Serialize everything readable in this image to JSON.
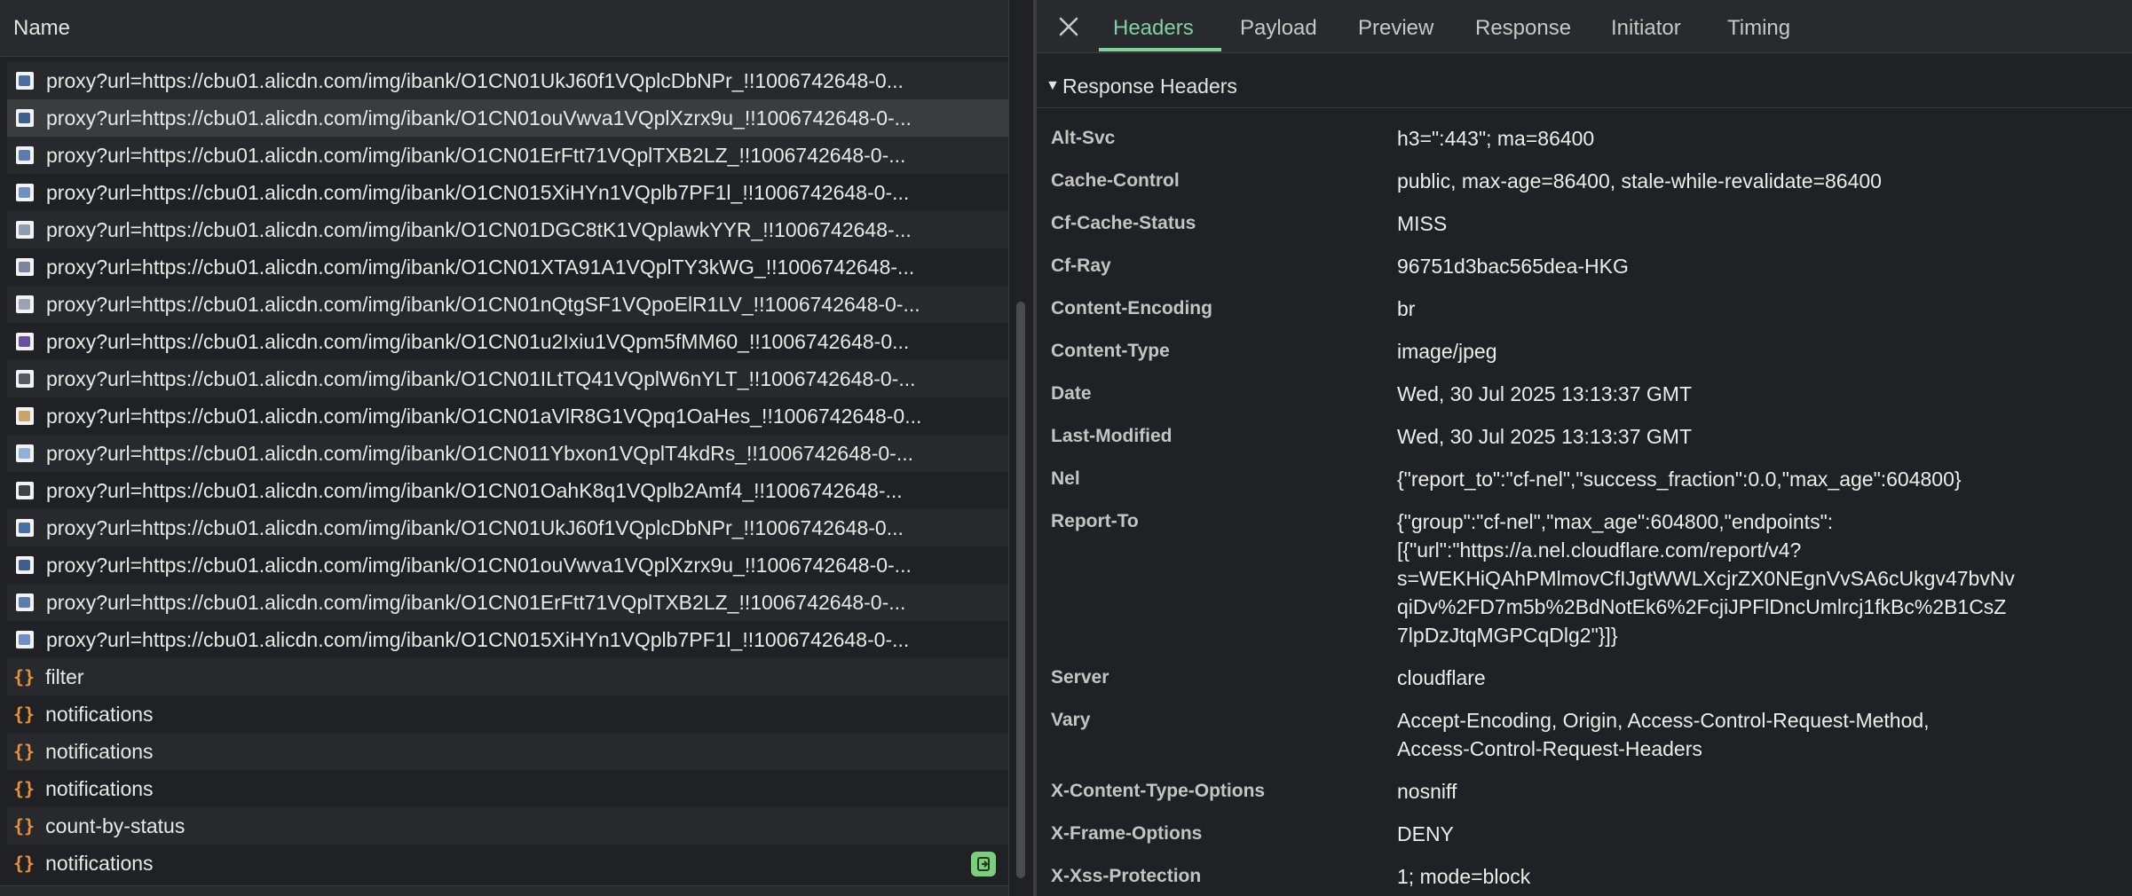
{
  "list": {
    "header": "Name",
    "rows": [
      {
        "name": "proxy?url=https://cbu01.alicdn.com/img/ibank/O1CN01UkJ60f1VQplcDbNPr_!!1006742648-0...",
        "kind": "image",
        "thumb": "#4a6fa5"
      },
      {
        "name": "proxy?url=https://cbu01.alicdn.com/img/ibank/O1CN01ouVwva1VQplXzrx9u_!!1006742648-0-...",
        "kind": "image",
        "thumb": "#3d5f8e"
      },
      {
        "name": "proxy?url=https://cbu01.alicdn.com/img/ibank/O1CN01ErFtt71VQplTXB2LZ_!!1006742648-0-...",
        "kind": "image",
        "thumb": "#5a7cb0"
      },
      {
        "name": "proxy?url=https://cbu01.alicdn.com/img/ibank/O1CN015XiHYn1VQplb7PF1l_!!1006742648-0-...",
        "kind": "image",
        "thumb": "#6d8fc2"
      },
      {
        "name": "proxy?url=https://cbu01.alicdn.com/img/ibank/O1CN01DGC8tK1VQplawkYYR_!!1006742648-...",
        "kind": "image",
        "thumb": "#8e9bb0"
      },
      {
        "name": "proxy?url=https://cbu01.alicdn.com/img/ibank/O1CN01XTA91A1VQplTY3kWG_!!1006742648-...",
        "kind": "image",
        "thumb": "#7a86a0"
      },
      {
        "name": "proxy?url=https://cbu01.alicdn.com/img/ibank/O1CN01nQtgSF1VQpoElR1LV_!!1006742648-0-...",
        "kind": "image",
        "thumb": "#9aa3b3"
      },
      {
        "name": "proxy?url=https://cbu01.alicdn.com/img/ibank/O1CN01u2Ixiu1VQpm5fMM60_!!1006742648-0...",
        "kind": "image",
        "thumb": "#6a4fa0"
      },
      {
        "name": "proxy?url=https://cbu01.alicdn.com/img/ibank/O1CN01ILtTQ41VQplW6nYLT_!!1006742648-0-...",
        "kind": "image",
        "thumb": "#555a63"
      },
      {
        "name": "proxy?url=https://cbu01.alicdn.com/img/ibank/O1CN01aVlR8G1VQpq1OaHes_!!1006742648-0...",
        "kind": "image",
        "thumb": "#c9a46b"
      },
      {
        "name": "proxy?url=https://cbu01.alicdn.com/img/ibank/O1CN011Ybxon1VQplT4kdRs_!!1006742648-0-...",
        "kind": "image",
        "thumb": "#8fb0d8"
      },
      {
        "name": "proxy?url=https://cbu01.alicdn.com/img/ibank/O1CN01OahK8q1VQplb2Amf4_!!1006742648-...",
        "kind": "image",
        "thumb": "#3f4248"
      },
      {
        "name": "proxy?url=https://cbu01.alicdn.com/img/ibank/O1CN01UkJ60f1VQplcDbNPr_!!1006742648-0...",
        "kind": "image",
        "thumb": "#4a6fa5"
      },
      {
        "name": "proxy?url=https://cbu01.alicdn.com/img/ibank/O1CN01ouVwva1VQplXzrx9u_!!1006742648-0-...",
        "kind": "image",
        "thumb": "#3d5f8e"
      },
      {
        "name": "proxy?url=https://cbu01.alicdn.com/img/ibank/O1CN01ErFtt71VQplTXB2LZ_!!1006742648-0-...",
        "kind": "image",
        "thumb": "#5a7cb0"
      },
      {
        "name": "proxy?url=https://cbu01.alicdn.com/img/ibank/O1CN015XiHYn1VQplb7PF1l_!!1006742648-0-...",
        "kind": "image",
        "thumb": "#6d8fc2"
      },
      {
        "name": "filter",
        "kind": "fetch"
      },
      {
        "name": "notifications",
        "kind": "fetch"
      },
      {
        "name": "notifications",
        "kind": "fetch"
      },
      {
        "name": "notifications",
        "kind": "fetch"
      },
      {
        "name": "count-by-status",
        "kind": "fetch"
      },
      {
        "name": "notifications",
        "kind": "fetch",
        "badge": true
      }
    ],
    "selected_index": 1,
    "fetch_icon": "{}"
  },
  "details": {
    "close_icon": "close-icon",
    "tabs": [
      "Headers",
      "Payload",
      "Preview",
      "Response",
      "Initiator",
      "Timing"
    ],
    "active_tab": "Headers",
    "section_title": "Response Headers",
    "headers": [
      {
        "key": "Alt-Svc",
        "value": "h3=\":443\"; ma=86400"
      },
      {
        "key": "Cache-Control",
        "value": "public, max-age=86400, stale-while-revalidate=86400"
      },
      {
        "key": "Cf-Cache-Status",
        "value": "MISS"
      },
      {
        "key": "Cf-Ray",
        "value": "96751d3bac565dea-HKG"
      },
      {
        "key": "Content-Encoding",
        "value": "br"
      },
      {
        "key": "Content-Type",
        "value": "image/jpeg"
      },
      {
        "key": "Date",
        "value": "Wed, 30 Jul 2025 13:13:37 GMT"
      },
      {
        "key": "Last-Modified",
        "value": "Wed, 30 Jul 2025 13:13:37 GMT"
      },
      {
        "key": "Nel",
        "value": "{\"report_to\":\"cf-nel\",\"success_fraction\":0.0,\"max_age\":604800}"
      },
      {
        "key": "Report-To",
        "value": "{\"group\":\"cf-nel\",\"max_age\":604800,\"endpoints\":\n[{\"url\":\"https://a.nel.cloudflare.com/report/v4?\ns=WEKHiQAhPMlmovCfIJgtWWLXcjrZX0NEgnVvSA6cUkgv47bvNv\nqiDv%2FD7m5b%2BdNotEk6%2FcjiJPFlDncUmlrcj1fkBc%2B1CsZ\n7lpDzJtqMGPCqDlg2\"}]}"
      },
      {
        "key": "Server",
        "value": "cloudflare"
      },
      {
        "key": "Vary",
        "value": "Accept-Encoding, Origin, Access-Control-Request-Method,\nAccess-Control-Request-Headers"
      },
      {
        "key": "X-Content-Type-Options",
        "value": "nosniff"
      },
      {
        "key": "X-Frame-Options",
        "value": "DENY"
      },
      {
        "key": "X-Xss-Protection",
        "value": "1; mode=block"
      }
    ]
  },
  "colors": {
    "accent": "#7fd1a0",
    "fetch_icon": "#e8913f",
    "badge": "#7ccd7c"
  }
}
